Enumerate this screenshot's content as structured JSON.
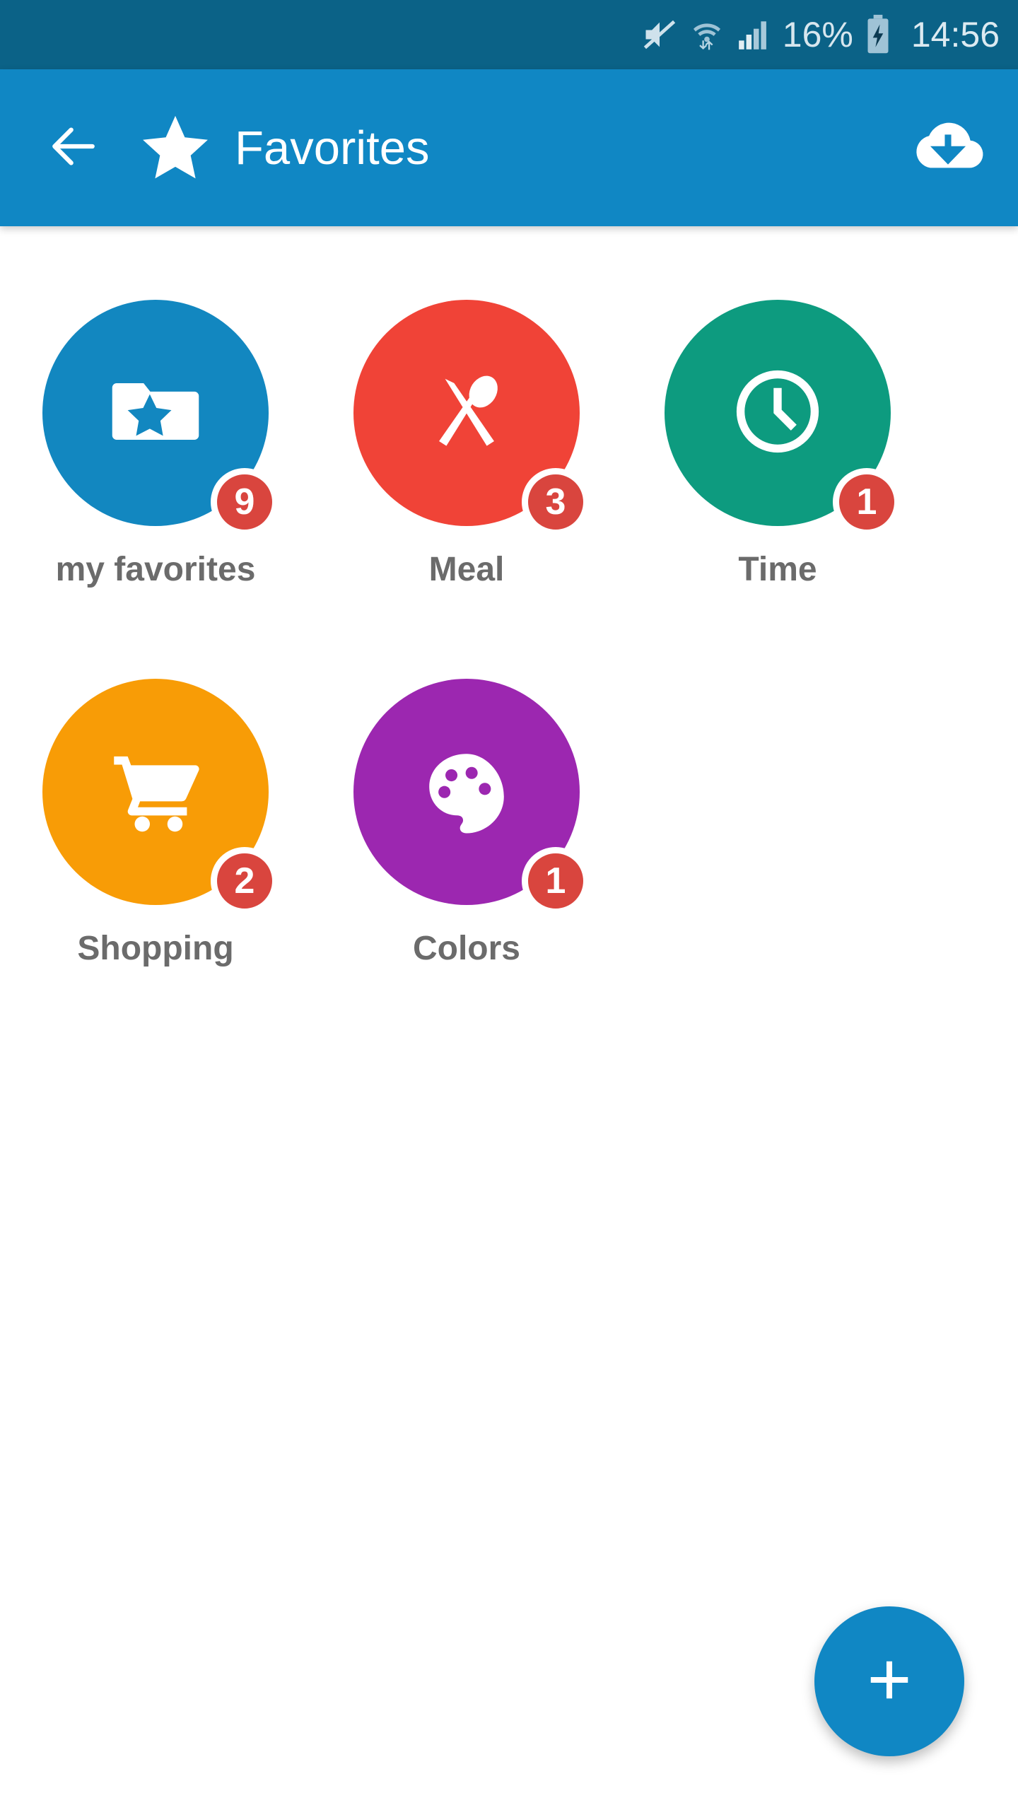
{
  "status_bar": {
    "background": "#0b6287",
    "battery_percent": "16%",
    "clock": "14:56",
    "icons": [
      "volume-muted-icon",
      "wifi-icon",
      "cellular-signal-icon",
      "battery-charging-icon"
    ]
  },
  "app_bar": {
    "background": "#1087c4",
    "back_icon": "back-arrow-icon",
    "leading_icon": "star-icon",
    "title": "Favorites",
    "action_icon": "cloud-download-icon"
  },
  "categories": [
    {
      "label": "my favorites",
      "badge": "9",
      "color": "#1287c0",
      "icon": "folder-star-icon"
    },
    {
      "label": "Meal",
      "badge": "3",
      "color": "#f04337",
      "icon": "cutlery-icon"
    },
    {
      "label": "Time",
      "badge": "1",
      "color": "#0d9b7f",
      "icon": "clock-icon"
    },
    {
      "label": "Shopping",
      "badge": "2",
      "color": "#f89c06",
      "icon": "shopping-cart-icon"
    },
    {
      "label": "Colors",
      "badge": "1",
      "color": "#9c27b0",
      "icon": "palette-icon"
    }
  ],
  "badge_color": "#d9453e",
  "fab": {
    "icon": "plus-icon",
    "color": "#1087c4"
  }
}
